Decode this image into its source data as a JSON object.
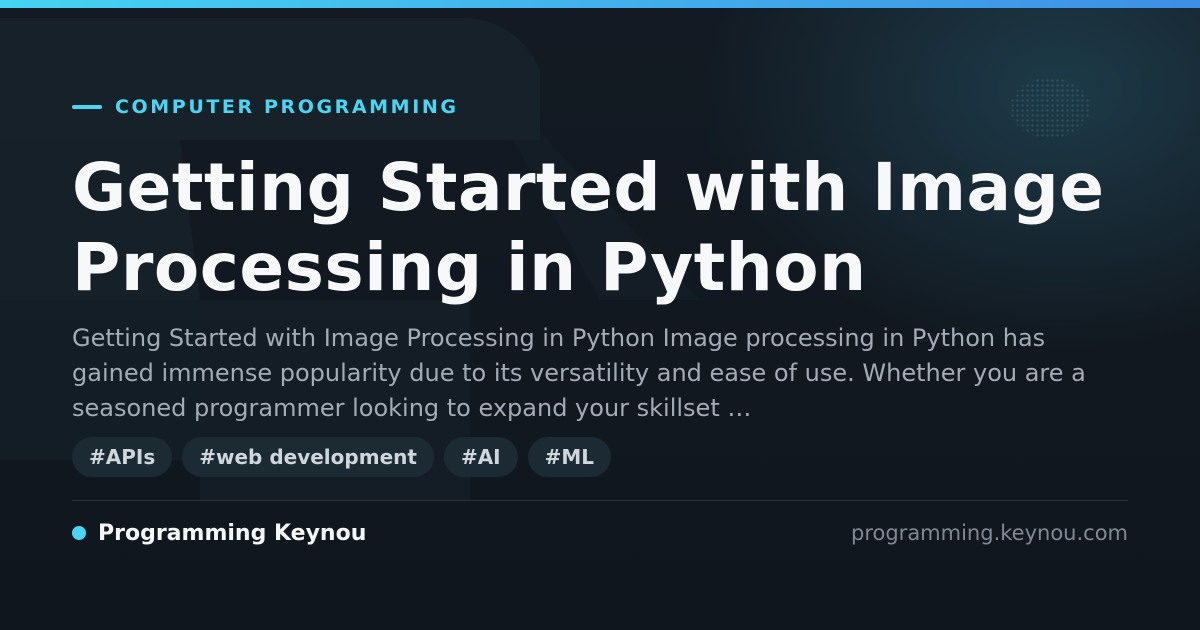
{
  "category": {
    "label": "COMPUTER PROGRAMMING"
  },
  "title": "Getting Started with Image Processing in Python",
  "description": "Getting Started with Image Processing in Python Image processing in Python has gained immense popularity due to its versatility and ease of use. Whether you are a seasoned programmer looking to expand your skillset …",
  "tags": [
    "#APIs",
    "#web development",
    "#AI",
    "#ML"
  ],
  "footer": {
    "brand": "Programming Keynou",
    "url": "programming.keynou.com"
  },
  "colors": {
    "accent": "#4ad6f3",
    "background": "#111821",
    "title": "#f7f8f9",
    "description": "#a3acb6"
  }
}
